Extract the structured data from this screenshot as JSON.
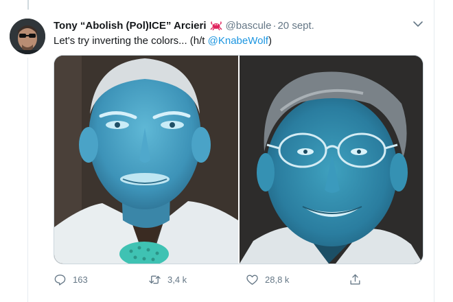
{
  "tweet": {
    "display_name": "Tony “Abolish (Pol)ICE” Arcieri",
    "handle": "@bascule",
    "separator": "·",
    "date": "20 sept.",
    "name_emoji": "crab-emoji-icon",
    "text_before": "Let's try inverting the colors... (h/t ",
    "mention": "@KnabeWolf",
    "text_after": ")"
  },
  "media": {
    "left_photo": "inverted-color-portrait-1",
    "right_photo": "inverted-color-portrait-2"
  },
  "actions": {
    "reply_count": "163",
    "retweet_count": "3,4 k",
    "like_count": "28,8 k"
  },
  "colors": {
    "text": "#14171a",
    "secondary": "#657786",
    "link": "#1b95e0",
    "crab": "#e0245e",
    "border": "#e6ecf0"
  }
}
